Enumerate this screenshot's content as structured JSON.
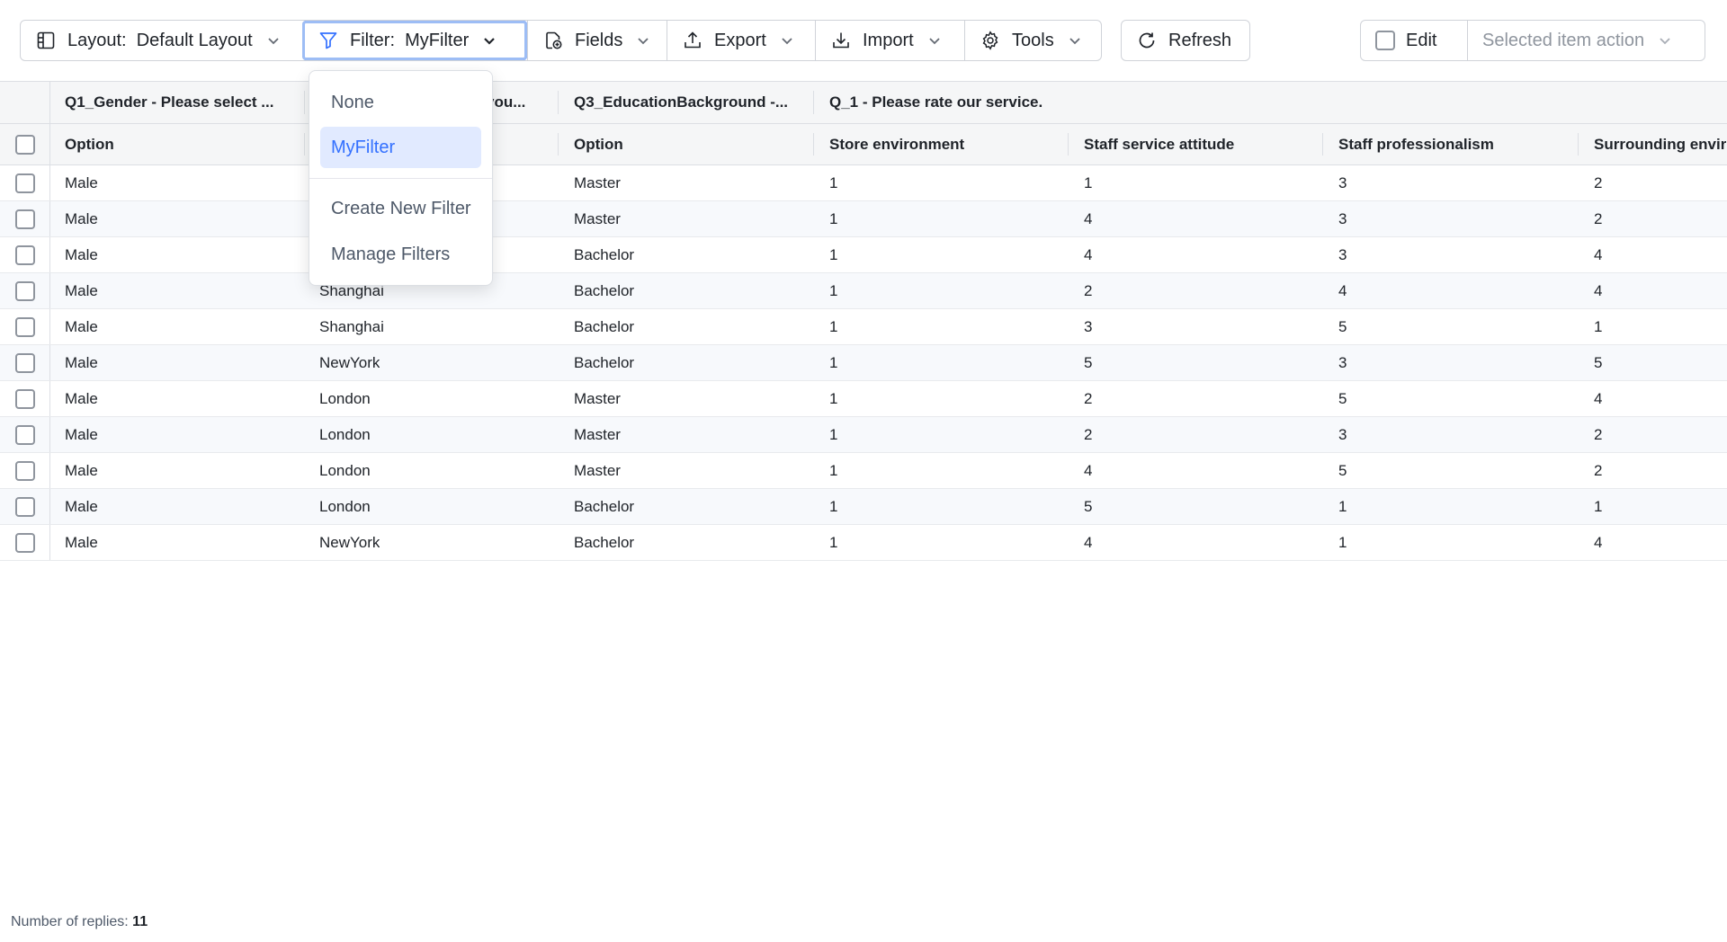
{
  "toolbar": {
    "layout_label": "Layout:",
    "layout_value": "Default Layout",
    "filter_label": "Filter:",
    "filter_value": "MyFilter",
    "fields": "Fields",
    "export": "Export",
    "import": "Import",
    "tools": "Tools",
    "refresh": "Refresh",
    "edit": "Edit",
    "selected_action": "Selected item action"
  },
  "filter_menu": {
    "items": [
      "None",
      "MyFilter",
      "Create New Filter",
      "Manage Filters"
    ],
    "selected": "MyFilter"
  },
  "table": {
    "group_headers": [
      "Q1_Gender - Please select ...",
      "you...",
      "Q3_EducationBackground -...",
      "Q_1 - Please rate our service."
    ],
    "columns": [
      "Option",
      "",
      "Option",
      "Store environment",
      "Staff service attitude",
      "Staff professionalism",
      "Surrounding envir"
    ],
    "rows": [
      [
        "Male",
        "",
        "Master",
        "1",
        "1",
        "3",
        "2"
      ],
      [
        "Male",
        "",
        "Master",
        "1",
        "4",
        "3",
        "2"
      ],
      [
        "Male",
        "",
        "Bachelor",
        "1",
        "4",
        "3",
        "4"
      ],
      [
        "Male",
        "Shanghai",
        "Bachelor",
        "1",
        "2",
        "4",
        "4"
      ],
      [
        "Male",
        "Shanghai",
        "Bachelor",
        "1",
        "3",
        "5",
        "1"
      ],
      [
        "Male",
        "NewYork",
        "Bachelor",
        "1",
        "5",
        "3",
        "5"
      ],
      [
        "Male",
        "London",
        "Master",
        "1",
        "2",
        "5",
        "4"
      ],
      [
        "Male",
        "London",
        "Master",
        "1",
        "2",
        "3",
        "2"
      ],
      [
        "Male",
        "London",
        "Master",
        "1",
        "4",
        "5",
        "2"
      ],
      [
        "Male",
        "London",
        "Bachelor",
        "1",
        "5",
        "1",
        "1"
      ],
      [
        "Male",
        "NewYork",
        "Bachelor",
        "1",
        "4",
        "1",
        "4"
      ]
    ]
  },
  "footer": {
    "label": "Number of replies:",
    "count": "11"
  },
  "colors": {
    "accent": "#3370ff",
    "selected_bg": "#e1eaff",
    "header_bg": "#f5f6f7"
  }
}
